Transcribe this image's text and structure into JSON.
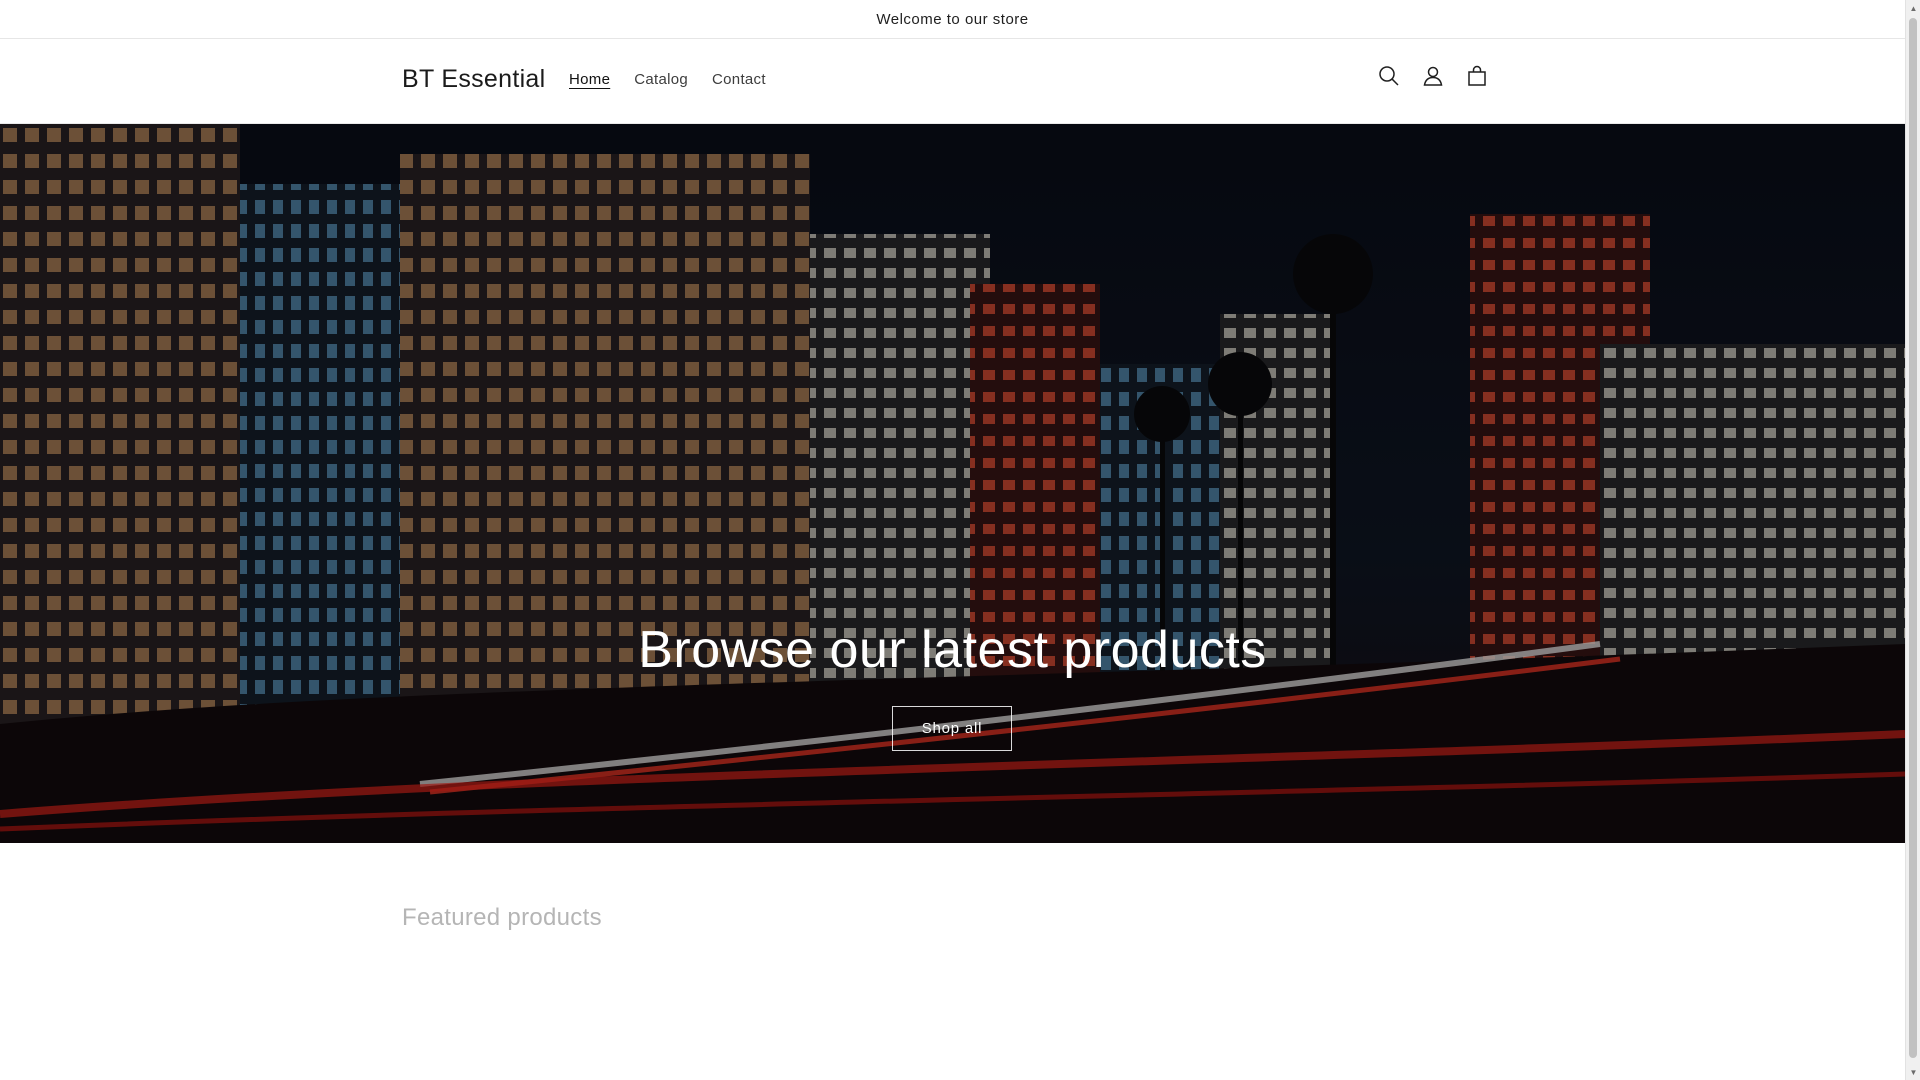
{
  "announcement": {
    "text": "Welcome to our store"
  },
  "header": {
    "logo": "BT Essential",
    "nav": [
      {
        "label": "Home",
        "active": true
      },
      {
        "label": "Catalog",
        "active": false
      },
      {
        "label": "Contact",
        "active": false
      }
    ],
    "icons": [
      "search-icon",
      "account-icon",
      "cart-icon"
    ]
  },
  "hero": {
    "title": "Browse our latest products",
    "button_label": "Shop all",
    "image_subject": "night city skyline with light trails"
  },
  "featured": {
    "title": "Featured products"
  },
  "colors": {
    "text": "#121212",
    "muted_heading": "#b5b5b5",
    "hero_button_border": "#ffffff"
  }
}
